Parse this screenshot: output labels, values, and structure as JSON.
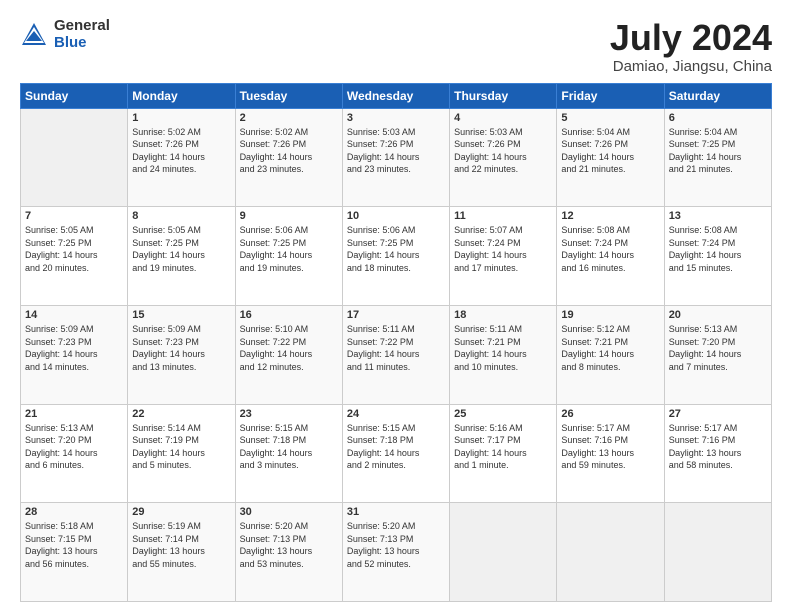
{
  "header": {
    "logo_general": "General",
    "logo_blue": "Blue",
    "title": "July 2024",
    "subtitle": "Damiao, Jiangsu, China"
  },
  "weekdays": [
    "Sunday",
    "Monday",
    "Tuesday",
    "Wednesday",
    "Thursday",
    "Friday",
    "Saturday"
  ],
  "weeks": [
    [
      {
        "day": "",
        "info": ""
      },
      {
        "day": "1",
        "info": "Sunrise: 5:02 AM\nSunset: 7:26 PM\nDaylight: 14 hours\nand 24 minutes."
      },
      {
        "day": "2",
        "info": "Sunrise: 5:02 AM\nSunset: 7:26 PM\nDaylight: 14 hours\nand 23 minutes."
      },
      {
        "day": "3",
        "info": "Sunrise: 5:03 AM\nSunset: 7:26 PM\nDaylight: 14 hours\nand 23 minutes."
      },
      {
        "day": "4",
        "info": "Sunrise: 5:03 AM\nSunset: 7:26 PM\nDaylight: 14 hours\nand 22 minutes."
      },
      {
        "day": "5",
        "info": "Sunrise: 5:04 AM\nSunset: 7:26 PM\nDaylight: 14 hours\nand 21 minutes."
      },
      {
        "day": "6",
        "info": "Sunrise: 5:04 AM\nSunset: 7:25 PM\nDaylight: 14 hours\nand 21 minutes."
      }
    ],
    [
      {
        "day": "7",
        "info": "Sunrise: 5:05 AM\nSunset: 7:25 PM\nDaylight: 14 hours\nand 20 minutes."
      },
      {
        "day": "8",
        "info": "Sunrise: 5:05 AM\nSunset: 7:25 PM\nDaylight: 14 hours\nand 19 minutes."
      },
      {
        "day": "9",
        "info": "Sunrise: 5:06 AM\nSunset: 7:25 PM\nDaylight: 14 hours\nand 19 minutes."
      },
      {
        "day": "10",
        "info": "Sunrise: 5:06 AM\nSunset: 7:25 PM\nDaylight: 14 hours\nand 18 minutes."
      },
      {
        "day": "11",
        "info": "Sunrise: 5:07 AM\nSunset: 7:24 PM\nDaylight: 14 hours\nand 17 minutes."
      },
      {
        "day": "12",
        "info": "Sunrise: 5:08 AM\nSunset: 7:24 PM\nDaylight: 14 hours\nand 16 minutes."
      },
      {
        "day": "13",
        "info": "Sunrise: 5:08 AM\nSunset: 7:24 PM\nDaylight: 14 hours\nand 15 minutes."
      }
    ],
    [
      {
        "day": "14",
        "info": "Sunrise: 5:09 AM\nSunset: 7:23 PM\nDaylight: 14 hours\nand 14 minutes."
      },
      {
        "day": "15",
        "info": "Sunrise: 5:09 AM\nSunset: 7:23 PM\nDaylight: 14 hours\nand 13 minutes."
      },
      {
        "day": "16",
        "info": "Sunrise: 5:10 AM\nSunset: 7:22 PM\nDaylight: 14 hours\nand 12 minutes."
      },
      {
        "day": "17",
        "info": "Sunrise: 5:11 AM\nSunset: 7:22 PM\nDaylight: 14 hours\nand 11 minutes."
      },
      {
        "day": "18",
        "info": "Sunrise: 5:11 AM\nSunset: 7:21 PM\nDaylight: 14 hours\nand 10 minutes."
      },
      {
        "day": "19",
        "info": "Sunrise: 5:12 AM\nSunset: 7:21 PM\nDaylight: 14 hours\nand 8 minutes."
      },
      {
        "day": "20",
        "info": "Sunrise: 5:13 AM\nSunset: 7:20 PM\nDaylight: 14 hours\nand 7 minutes."
      }
    ],
    [
      {
        "day": "21",
        "info": "Sunrise: 5:13 AM\nSunset: 7:20 PM\nDaylight: 14 hours\nand 6 minutes."
      },
      {
        "day": "22",
        "info": "Sunrise: 5:14 AM\nSunset: 7:19 PM\nDaylight: 14 hours\nand 5 minutes."
      },
      {
        "day": "23",
        "info": "Sunrise: 5:15 AM\nSunset: 7:18 PM\nDaylight: 14 hours\nand 3 minutes."
      },
      {
        "day": "24",
        "info": "Sunrise: 5:15 AM\nSunset: 7:18 PM\nDaylight: 14 hours\nand 2 minutes."
      },
      {
        "day": "25",
        "info": "Sunrise: 5:16 AM\nSunset: 7:17 PM\nDaylight: 14 hours\nand 1 minute."
      },
      {
        "day": "26",
        "info": "Sunrise: 5:17 AM\nSunset: 7:16 PM\nDaylight: 13 hours\nand 59 minutes."
      },
      {
        "day": "27",
        "info": "Sunrise: 5:17 AM\nSunset: 7:16 PM\nDaylight: 13 hours\nand 58 minutes."
      }
    ],
    [
      {
        "day": "28",
        "info": "Sunrise: 5:18 AM\nSunset: 7:15 PM\nDaylight: 13 hours\nand 56 minutes."
      },
      {
        "day": "29",
        "info": "Sunrise: 5:19 AM\nSunset: 7:14 PM\nDaylight: 13 hours\nand 55 minutes."
      },
      {
        "day": "30",
        "info": "Sunrise: 5:20 AM\nSunset: 7:13 PM\nDaylight: 13 hours\nand 53 minutes."
      },
      {
        "day": "31",
        "info": "Sunrise: 5:20 AM\nSunset: 7:13 PM\nDaylight: 13 hours\nand 52 minutes."
      },
      {
        "day": "",
        "info": ""
      },
      {
        "day": "",
        "info": ""
      },
      {
        "day": "",
        "info": ""
      }
    ]
  ]
}
